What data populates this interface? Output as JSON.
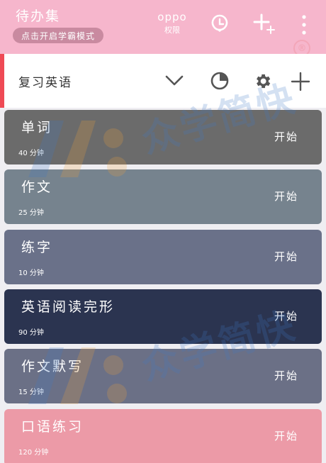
{
  "header": {
    "title": "待办集",
    "mode_button": "点击开启学霸模式",
    "brand": "oppo",
    "brand_sub": "权限",
    "icons": [
      "clock-icon",
      "plus-icon",
      "more-icon"
    ],
    "registered_mark": "®"
  },
  "category": {
    "name": "复习英语",
    "icons": [
      "chevron-down-icon",
      "pie-chart-icon",
      "gear-icon",
      "plus-icon"
    ],
    "accent_color": "#ef4a55"
  },
  "tasks": [
    {
      "title": "单词",
      "duration": "40 分钟",
      "action": "开始",
      "color": "#6b6b6b"
    },
    {
      "title": "作文",
      "duration": "25 分钟",
      "action": "开始",
      "color": "#76838e"
    },
    {
      "title": "练字",
      "duration": "10 分钟",
      "action": "开始",
      "color": "#6a7189"
    },
    {
      "title": "英语阅读完形",
      "duration": "90 分钟",
      "action": "开始",
      "color": "#2b3450"
    },
    {
      "title": "作文默写",
      "duration": "15 分钟",
      "action": "开始",
      "color": "#6b7086"
    },
    {
      "title": "口语练习",
      "duration": "120 分钟",
      "action": "开始",
      "color": "#ec9aa7"
    }
  ],
  "watermark": {
    "text": "众学简快"
  },
  "colors": {
    "header": "#f6b6cc",
    "background": "#efeef2"
  }
}
